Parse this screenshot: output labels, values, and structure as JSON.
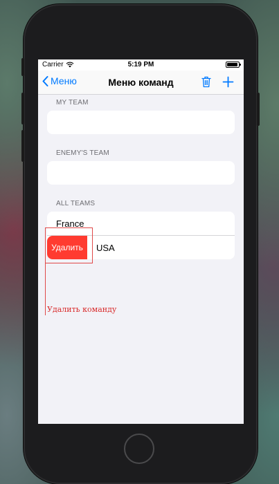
{
  "status_bar": {
    "carrier": "Carrier",
    "time": "5:19 PM"
  },
  "nav": {
    "back_label": "Меню",
    "title": "Меню команд",
    "trash_icon": "trash-icon",
    "add_icon": "plus-icon",
    "accent_color": "#007aff"
  },
  "sections": {
    "my_team": {
      "header": "MY TEAM",
      "value": ""
    },
    "enemy_team": {
      "header": "ENEMY'S TEAM",
      "value": ""
    },
    "all_teams": {
      "header": "ALL TEAMS",
      "items": [
        "France",
        "USA"
      ]
    }
  },
  "swipe_action": {
    "label": "Удалить",
    "color": "#ff3b30"
  },
  "annotation": {
    "label": "Удалить команду",
    "color": "#e04848"
  }
}
